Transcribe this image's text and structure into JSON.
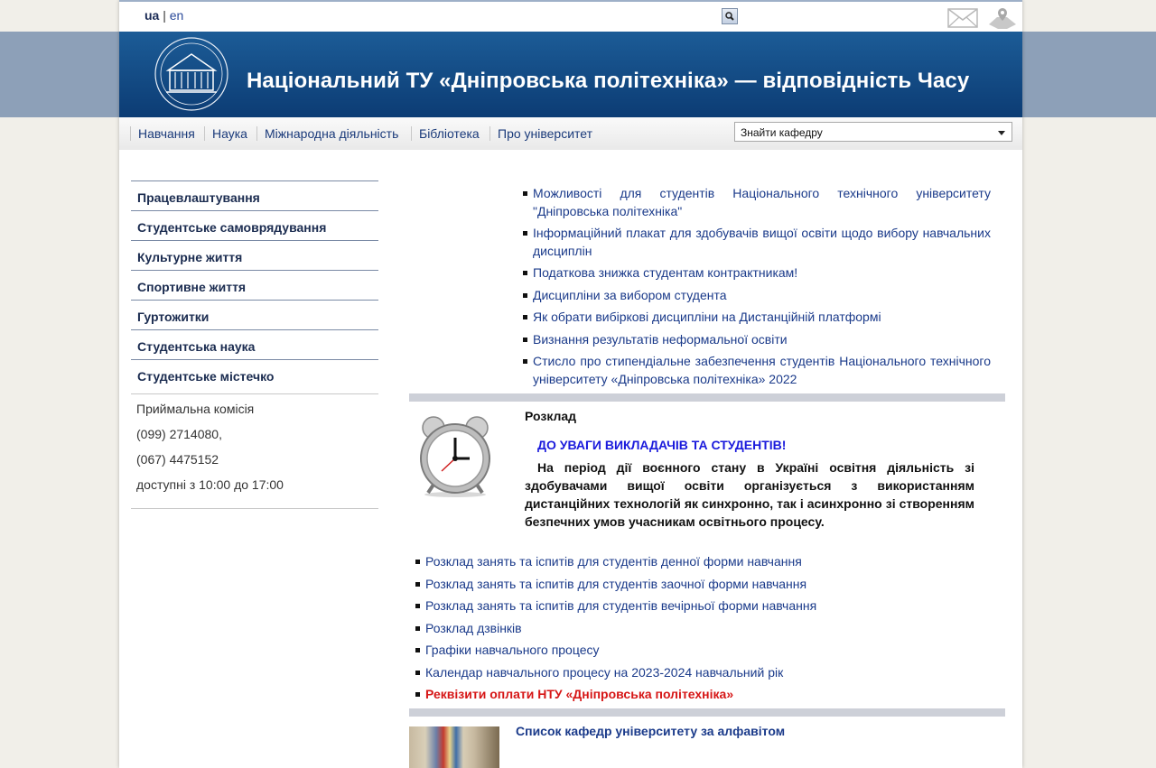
{
  "lang": {
    "ua": "ua",
    "separator": "|",
    "en": "en"
  },
  "header": {
    "title": "Національний ТУ «Дніпровська політехніка» — відповідність Часу"
  },
  "nav": {
    "items": [
      "Навчання",
      "Наука",
      "Міжнародна діяльність",
      "Бібліотека",
      "Про університет"
    ],
    "dept_select": "Знайти кафедру"
  },
  "sidebar": {
    "items": [
      "Працевлаштування",
      "Студентське самоврядування",
      "Культурне життя",
      "Спортивне життя",
      "Гуртожитки",
      "Студентська наука",
      "Студентське містечко"
    ],
    "info": [
      "Приймальна комісія",
      "(099) 2714080,",
      "(067) 4475152",
      "доступні з 10:00 до 17:00"
    ]
  },
  "news": [
    "Можливості для студентів Національного технічного університету \"Дніпровська політехніка\"",
    "Інформаційний плакат для здобувачів вищої освіти щодо вибору навчальних дисциплін",
    "Податкова знижка студентам контрактникам!",
    "Дисципліни за вибором студента",
    "Як обрати вибіркові дисципліни на Дистанційній платформі",
    "Визнання результатів неформальної освіти",
    "Стисло про стипендіальне забезпечення студентів Національного технічного університету «Дніпровська політехніка» 2022"
  ],
  "schedule": {
    "title": "Розклад",
    "notice_head": "ДО УВАГИ ВИКЛАДАЧІВ ТА СТУДЕНТІВ!",
    "notice_body": "На період дії воєнного стану в Україні освітня діяльність зі здобувачами вищої освіти організується з використанням дистанційних технологій як синхронно, так і асинхронно зі створенням безпечних умов учасникам освітнього процесу.",
    "links": [
      "Розклад занять та іспитів для студентів денної форми навчання",
      "Розклад занять та іспитів для студентів заочної форми навчання",
      "Розклад занять та іспитів для студентів вечірньої форми навчання",
      "Розклад дзвінків",
      "Графіки навчального процесу",
      "Календар навчального процесу на 2023-2024 навчальний рік",
      "Реквізити оплати НТУ «Дніпровська політехніка»"
    ]
  },
  "departments": {
    "link": "Список кафедр університету за алфавітом"
  },
  "colors": {
    "header": "#0c3c74",
    "link": "#1a3a8a",
    "alert": "#d61616",
    "notice": "#1a1adc"
  }
}
